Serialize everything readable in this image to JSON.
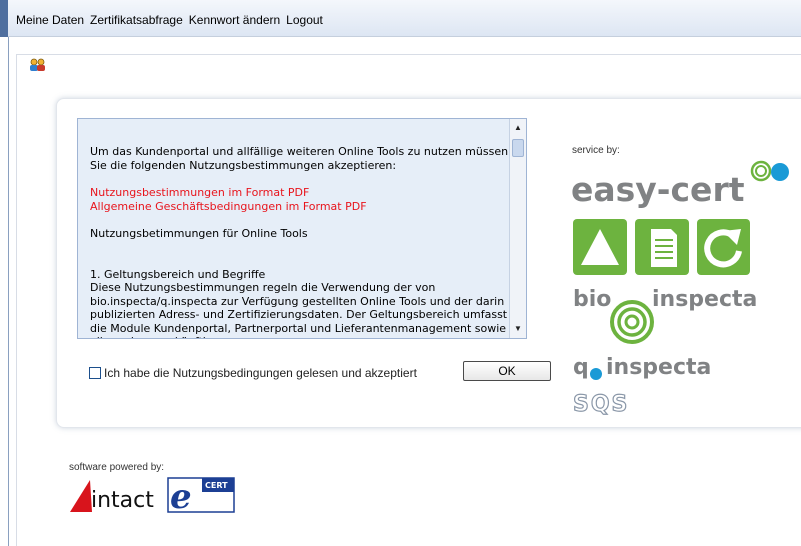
{
  "menu": {
    "items": [
      {
        "label": "Meine Daten"
      },
      {
        "label": "Zertifikatsabfrage"
      },
      {
        "label": "Kennwort ändern"
      },
      {
        "label": "Logout"
      }
    ]
  },
  "terms": {
    "intro": "Um das Kundenportal und allfällige weiteren Online Tools zu nutzen müssen Sie die folgenden Nutzungsbestimmungen akzeptieren:",
    "link_pdf": "Nutzungsbestimmungen im Format PDF",
    "link_agb": "Allgemeine Geschäftsbedingungen im Format PDF",
    "heading": "Nutzungsbetimmungen für Online Tools",
    "section_title": "1. Geltungsbereich und Begriffe",
    "section_body": "Diese Nutzungsbestimmungen regeln die Verwendung der von bio.inspecta/q.inspecta zur Verfügung gestellten Online Tools und der darin publizierten Adress- und Zertifizierungsdaten. Der Geltungsbereich umfasst die Module Kundenportal, Partnerportal und Lieferantenmanagement sowie alle anderen zukünftig von"
  },
  "accept": {
    "label": "Ich habe die Nutzungsbedingungen gelesen und akzeptiert",
    "ok_label": "OK"
  },
  "service": {
    "label": "service by:",
    "easy_cert": "easy-cert",
    "bio": "bio",
    "inspecta": "inspecta",
    "q": "q",
    "q_inspecta": "inspecta",
    "sqs": "SQS"
  },
  "software": {
    "label": "software powered by:",
    "intact": "intact",
    "ecert": "CERT"
  },
  "colors": {
    "green": "#6db33f",
    "gray_logo": "#808284",
    "blue_dot": "#1a9ad6",
    "link_red": "#e8141c",
    "navy": "#1c3f94"
  }
}
